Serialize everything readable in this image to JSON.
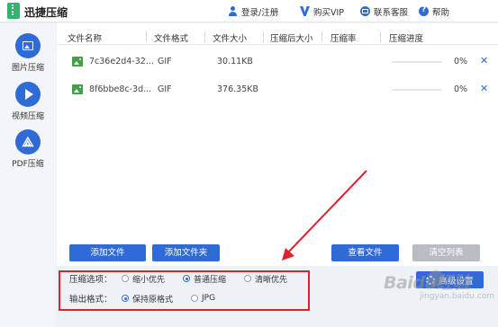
{
  "app": {
    "title": "迅捷压缩",
    "icon": "zip-file-icon"
  },
  "header": {
    "login": "登录/注册",
    "vip": "购买VIP",
    "service": "联系客服",
    "help": "帮助"
  },
  "sidebar": {
    "items": [
      {
        "label": "图片压缩",
        "icon": "image-icon"
      },
      {
        "label": "视频压缩",
        "icon": "play-icon"
      },
      {
        "label": "PDF压缩",
        "icon": "pdf-icon"
      }
    ]
  },
  "table": {
    "headers": [
      "文件名称",
      "文件格式",
      "文件大小",
      "压缩后大小",
      "压缩率",
      "压缩进度"
    ],
    "rows": [
      {
        "name": "7c36e2d4-32...",
        "format": "GIF",
        "size": "30.11KB",
        "after": "",
        "ratio": "",
        "progress": 0,
        "progress_text": "0%",
        "delete": "✕"
      },
      {
        "name": "8f6bbe8c-3d...",
        "format": "GIF",
        "size": "376.35KB",
        "after": "",
        "ratio": "",
        "progress": 0,
        "progress_text": "0%",
        "delete": "✕"
      }
    ]
  },
  "actions": {
    "add_file": "添加文件",
    "add_folder": "添加文件夹",
    "view_files": "查看文件",
    "clear_list": "清空列表",
    "advanced": "高级设置"
  },
  "options": {
    "compress_label": "压缩选项：",
    "compress_choices": [
      {
        "label": "缩小优先",
        "selected": false
      },
      {
        "label": "普通压缩",
        "selected": true
      },
      {
        "label": "清晰优先",
        "selected": false
      }
    ],
    "format_label": "输出格式：",
    "format_choices": [
      {
        "label": "保持原格式",
        "selected": true
      },
      {
        "label": "JPG",
        "selected": false
      }
    ]
  },
  "watermark": {
    "main": "Baidu经验",
    "sub": "jingyan.baidu.com"
  },
  "colors": {
    "primary": "#2f6bd6",
    "annotation": "#e0212b",
    "file_icon": "#43a047",
    "disabled_button": "#b9bcc3"
  }
}
